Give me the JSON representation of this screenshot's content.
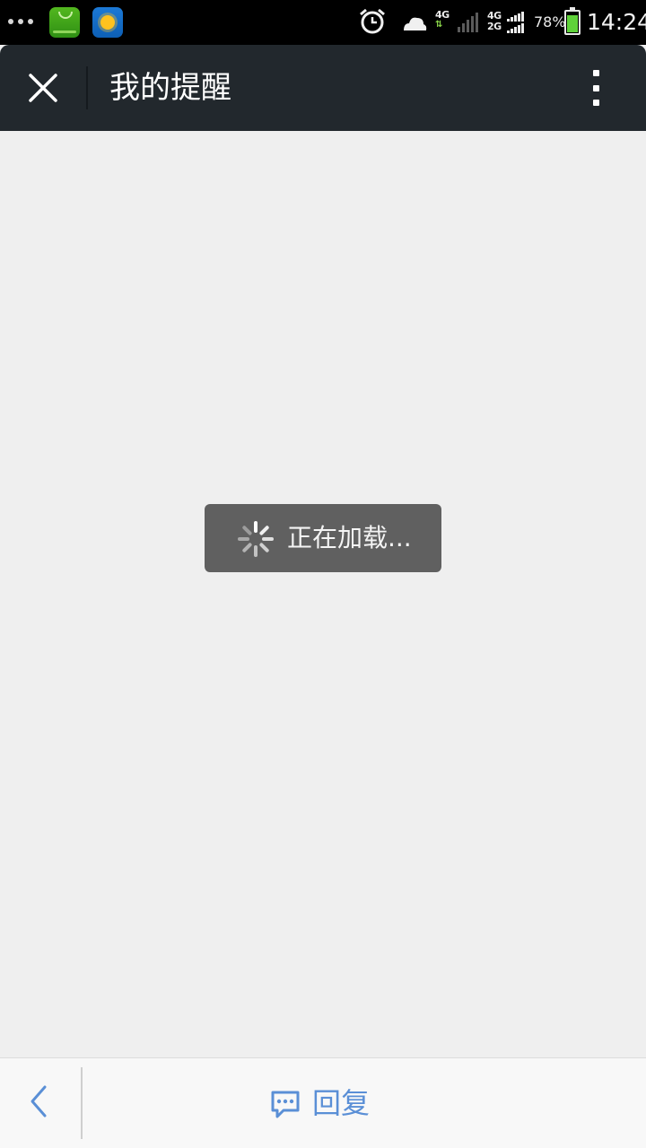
{
  "status_bar": {
    "network_primary": "4G",
    "network_dual_top": "4G",
    "network_dual_bottom": "2G",
    "battery_percent_label": "78%",
    "battery_level": 0.78,
    "time": "14:24",
    "icons": [
      "overflow-dots-icon",
      "app-market-icon",
      "weather-app-icon",
      "alarm-icon",
      "cloud-sync-icon",
      "signal-icon",
      "battery-icon"
    ]
  },
  "header": {
    "title": "我的提醒",
    "close_icon": "close-icon",
    "more_icon": "more-vertical-icon"
  },
  "main": {
    "loading_text": "正在加载..."
  },
  "footer": {
    "reply_label": "回复",
    "back_icon": "chevron-left-icon",
    "reply_icon": "chat-bubble-icon"
  },
  "colors": {
    "header_bg": "#22282d",
    "content_bg": "#efefef",
    "toast_bg": "#606060",
    "accent": "#5a8fd6",
    "battery": "#5fd23a"
  }
}
